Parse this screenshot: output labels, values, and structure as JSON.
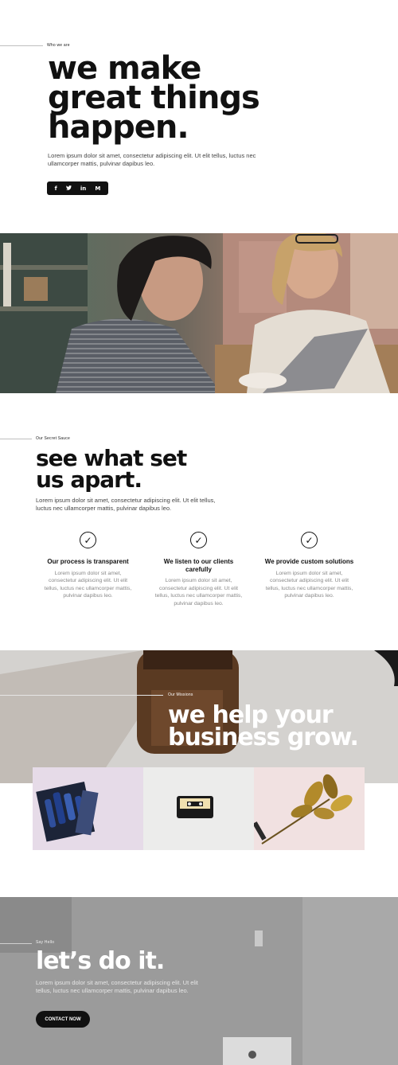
{
  "hero": {
    "eyebrow": "Who we are",
    "title_line1": "we make",
    "title_line2": "great things",
    "title_line3": "happen.",
    "text": "Lorem ipsum dolor sit amet, consectetur adipiscing elit. Ut elit tellus, luctus nec ullamcorper mattis, pulvinar dapibus leo.",
    "social": [
      "f",
      "t",
      "in",
      "M"
    ]
  },
  "sauce": {
    "eyebrow": "Our Secret Sauce",
    "title_line1": "see what set",
    "title_line2": "us apart.",
    "text": "Lorem ipsum dolor sit amet, consectetur adipiscing elit. Ut elit tellus, luctus nec ullamcorper mattis, pulvinar dapibus leo.",
    "features": [
      {
        "title": "Our process is transparent",
        "text": "Lorem ipsum dolor sit amet, consectetur adipiscing elit. Ut elit tellus, luctus nec ullamcorper mattis, pulvinar dapibus leo."
      },
      {
        "title": "We listen to our clients carefully",
        "text": "Lorem ipsum dolor sit amet, consectetur adipiscing elit. Ut elit tellus, luctus nec ullamcorper mattis, pulvinar dapibus leo."
      },
      {
        "title": "We provide custom solutions",
        "text": "Lorem ipsum dolor sit amet, consectetur adipiscing elit. Ut elit tellus, luctus nec ullamcorper mattis, pulvinar dapibus leo."
      }
    ]
  },
  "mission": {
    "eyebrow": "Our Missions",
    "title_line1": "we help your",
    "title_line2": "business grow."
  },
  "contact": {
    "eyebrow": "Say Hello",
    "title": "let’s do it.",
    "text": "Lorem ipsum dolor sit amet, consectetur adipiscing elit. Ut elit tellus, luctus nec ullamcorper mattis, pulvinar dapibus leo.",
    "button": "CONTACT NOW"
  },
  "colors": {
    "accent": "#111111",
    "muted_text": "#888888"
  }
}
